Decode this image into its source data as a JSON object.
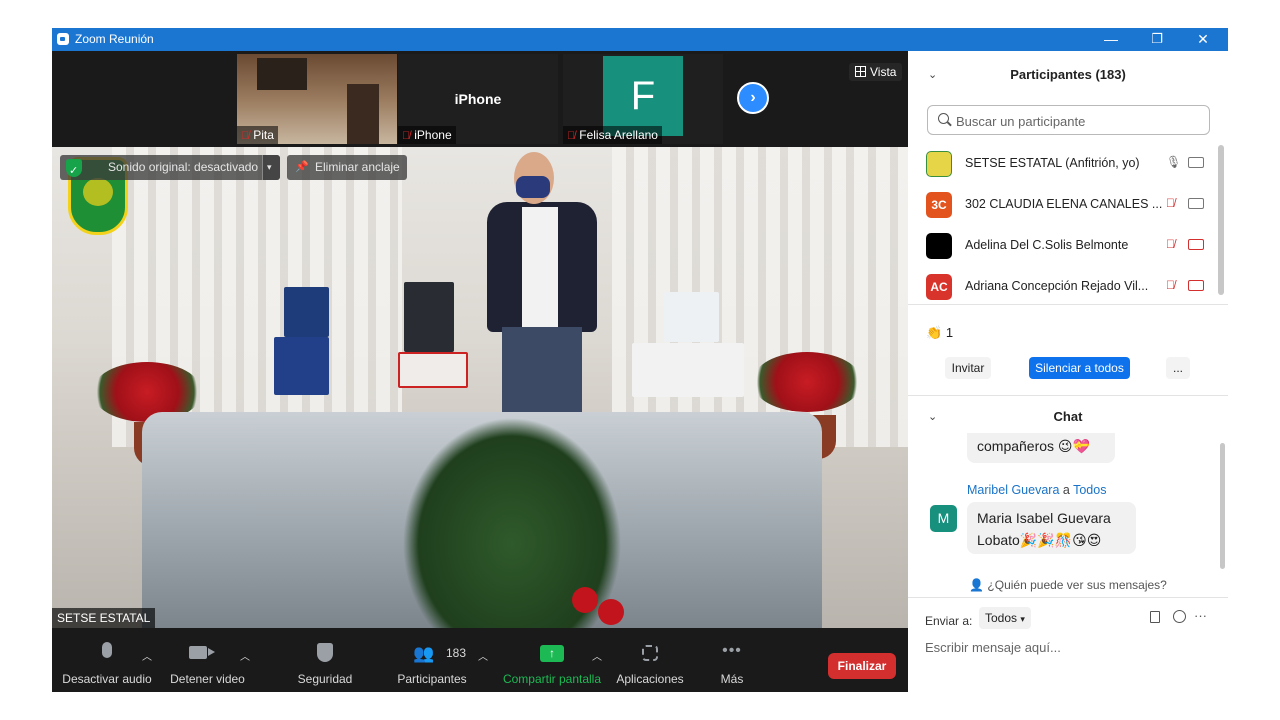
{
  "window": {
    "title": "Zoom Reunión",
    "minimize": "—",
    "restore": "❐",
    "close": "✕"
  },
  "thumbnails": [
    {
      "name": "Pita",
      "muted": true
    },
    {
      "name": "iPhone",
      "muted": true,
      "title": "iPhone"
    },
    {
      "name": "Felisa Arellano",
      "muted": true,
      "initial": "F"
    }
  ],
  "view_button": {
    "label": "Vista"
  },
  "overlay": {
    "original_sound": "Sonido original: desactivado",
    "unpin": "Eliminar anclaje"
  },
  "main_video_label": "SETSE ESTATAL",
  "toolbar": {
    "mute": "Desactivar audio",
    "stop_video": "Detener video",
    "security": "Seguridad",
    "participants": "Participantes",
    "participants_count": "183",
    "share": "Compartir pantalla",
    "apps": "Aplicaciones",
    "more": "Más",
    "end": "Finalizar"
  },
  "participants_panel": {
    "title": "Participantes (183)",
    "search_placeholder": "Buscar un participante",
    "list": [
      {
        "name": "SETSE ESTATAL (Anfitrión, yo)",
        "initials": "",
        "color": "#e7d548",
        "muted": false,
        "video_off": false
      },
      {
        "name": "302 CLAUDIA ELENA CANALES ...",
        "initials": "3C",
        "color": "#e2531d",
        "muted": true,
        "video_off": false
      },
      {
        "name": "Adelina Del C.Solis Belmonte",
        "initials": "",
        "color": "#000000",
        "muted": true,
        "video_off": true
      },
      {
        "name": "Adriana Concepción Rejado Vil...",
        "initials": "AC",
        "color": "#d9342b",
        "muted": true,
        "video_off": true
      }
    ],
    "reaction_count": "1",
    "invite": "Invitar",
    "mute_all": "Silenciar a todos",
    "more": "..."
  },
  "chat": {
    "title": "Chat",
    "prev_message": "compañeros 😉💝",
    "sender": "Maribel Guevara",
    "sender_to_word": "a",
    "recipient": "Todos",
    "avatar_initial": "M",
    "message_line1": "Maria Isabel Guevara",
    "message_line2": "Lobato🎉🎉🎊😘😍",
    "who_can_see": "¿Quién puede ver sus mensajes?",
    "send_to_label": "Enviar a:",
    "send_to_value": "Todos",
    "input_placeholder": "Escribir mensaje aquí..."
  },
  "colors": {
    "titlebar": "#1b76d2",
    "accent_blue": "#0e72ed",
    "end_red": "#d32f2f",
    "share_green": "#1db954",
    "link_blue": "#1a73c8"
  }
}
